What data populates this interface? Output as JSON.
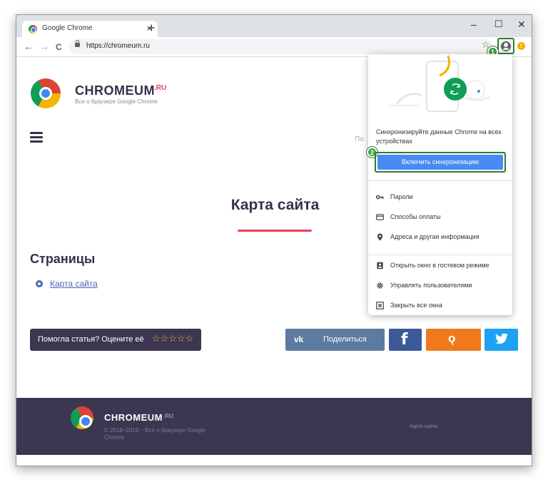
{
  "browser": {
    "tab_title": "Google Chrome",
    "tab_close": "×",
    "new_tab": "+",
    "minimize": "–",
    "maximize": "☐",
    "close": "✕",
    "back": "←",
    "forward": "→",
    "reload": "C",
    "url": "https://chromeum.ru",
    "star": "☆",
    "warning": "!"
  },
  "badges": {
    "profile": "1",
    "sync": "2"
  },
  "site": {
    "logo_name": "CHROMEUM",
    "logo_ru": ".RU",
    "logo_sub": "Все о браузере Google Chrome",
    "nav_partial": "По",
    "page_title": "Карта сайта",
    "section_title": "Страницы",
    "link_sitemap": "Карта сайта",
    "rate_text": "Помогла статья? Оцените её",
    "rate_stars": "☆☆☆☆☆",
    "share_vk_icon": "vk",
    "share_label": "Поделиться",
    "fb_icon": "f",
    "ok_icon": "ǫ",
    "footer_logo_name": "CHROMEUM",
    "footer_logo_ru": ".RU",
    "footer_sub_1": "© 2018–2019 – Все о браузере Google",
    "footer_sub_2": "Chrome",
    "footer_link": "Карта сайта"
  },
  "dropdown": {
    "sync_text": "Синхронизируйте данные Chrome на всех устройствах",
    "sync_button": "Включить синхронизацию",
    "items": [
      {
        "icon": "key-icon",
        "label": "Пароли"
      },
      {
        "icon": "credit-card-icon",
        "label": "Способы оплаты"
      },
      {
        "icon": "location-pin-icon",
        "label": "Адреса и другая информация"
      },
      {
        "icon": "guest-badge-icon",
        "label": "Открыть окно в гостевом режиме"
      },
      {
        "icon": "gear-icon",
        "label": "Управлять пользователями"
      },
      {
        "icon": "close-window-icon",
        "label": "Закрыть все окна"
      }
    ]
  },
  "colors": {
    "brand_dark": "#3d3650",
    "brand_red": "#e8415f",
    "sync_blue": "#4a8af4",
    "highlight_green": "#2e7d32",
    "vk": "#5d7aa0",
    "facebook": "#3b5998",
    "odnoklassniki": "#f07a1b",
    "twitter": "#1da1f2"
  }
}
